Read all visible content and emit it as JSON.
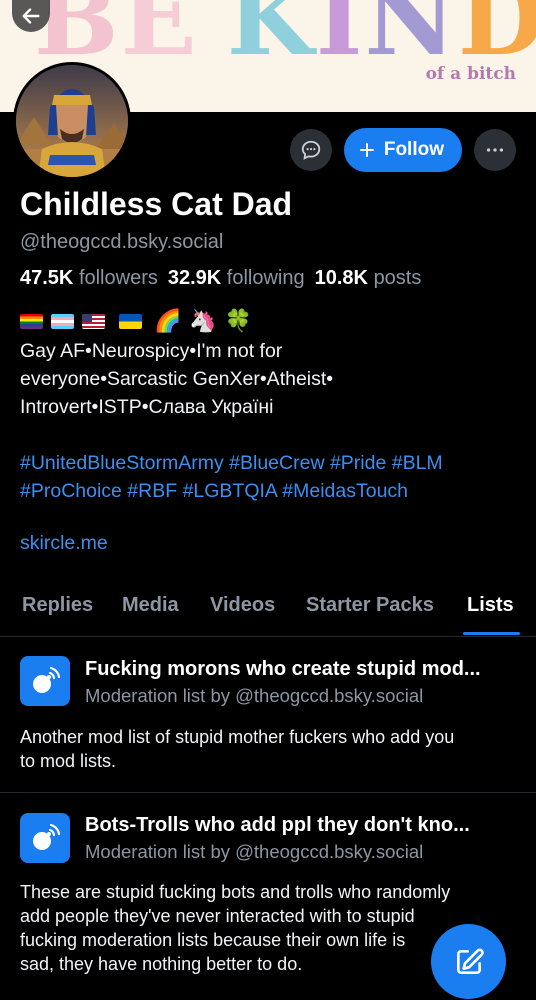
{
  "banner": {
    "title": "BE KIND",
    "subtitle": "of a bitch",
    "letter_colors": [
      "#f3c3cf",
      "#f6cdd6",
      "#8fd0dc",
      "#c79ad8",
      "#a39ad3",
      "#f7a94a",
      "#f6c33d"
    ]
  },
  "profile": {
    "display_name": "Childless Cat Dad",
    "handle": "@theogccd.bsky.social",
    "followers_count": "47.5K",
    "followers_label": "followers",
    "following_count": "32.9K",
    "following_label": "following",
    "posts_count": "10.8K",
    "posts_label": "posts",
    "flag_emojis": [
      "rainbow-flag",
      "trans-flag",
      "us-flag",
      "ukraine-flag"
    ],
    "emoji_rainbow": "🌈",
    "emoji_unicorn": "🦄",
    "emoji_clover": "🍀",
    "bio_lines": [
      "Gay AF•Neurospicy•I'm not for",
      "everyone•Sarcastic GenXer•Atheist•",
      "Introvert•ISTP•Слава Україні"
    ],
    "hashtag_lines": [
      "#UnitedBlueStormArmy #BlueCrew #Pride #BLM",
      "#ProChoice #RBF #LGBTQIA #MeidasTouch"
    ],
    "link": "skircle.me"
  },
  "actions": {
    "message_icon": "chat-bubble-icon",
    "follow_label": "Follow",
    "more_icon": "ellipsis-icon"
  },
  "tabs": [
    {
      "label": "Replies",
      "active": false
    },
    {
      "label": "Media",
      "active": false
    },
    {
      "label": "Videos",
      "active": false
    },
    {
      "label": "Starter Packs",
      "active": false
    },
    {
      "label": "Lists",
      "active": true
    }
  ],
  "lists": [
    {
      "title": "Fucking morons who create stupid mod...",
      "meta": "Moderation list by @theogccd.bsky.social",
      "description_lines": [
        "Another mod list of stupid mother fuckers who add you",
        "to mod lists."
      ]
    },
    {
      "title": "Bots-Trolls who add ppl they don't kno...",
      "meta": "Moderation list by @theogccd.bsky.social",
      "description_lines": [
        "These are stupid fucking bots and trolls who randomly",
        "add people they've never interacted with to stupid",
        "fucking moderation lists because their own life is",
        "sad, they have nothing better to do."
      ]
    }
  ],
  "colors": {
    "accent": "#1a7df0",
    "link": "#3b8ff0",
    "muted": "#8d96a3",
    "background": "#000000"
  }
}
